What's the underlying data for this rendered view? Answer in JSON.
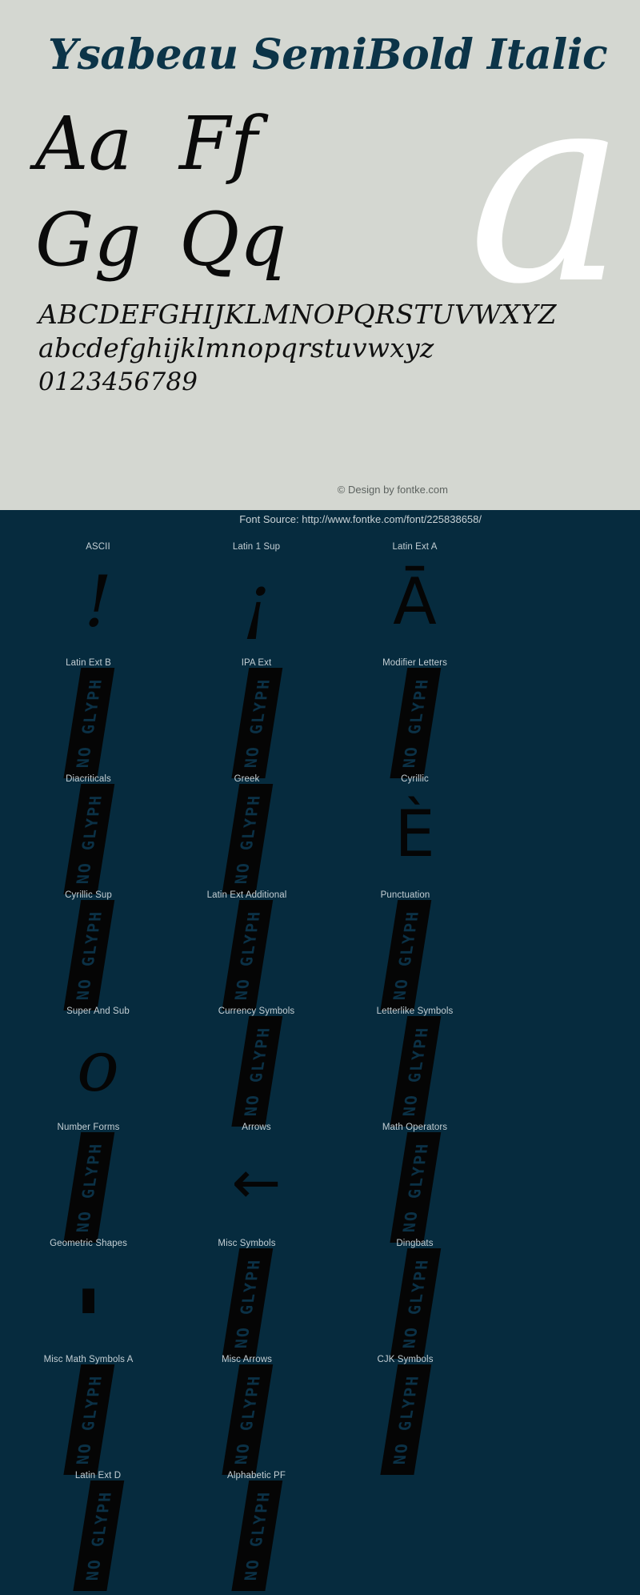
{
  "specimen": {
    "title": "Ysabeau SemiBold Italic",
    "hero_glyph": "a",
    "pairs": [
      "Aa",
      "Ff",
      "Gg",
      "Qq"
    ],
    "alphabet_upper": "ABCDEFGHIJKLMNOPQRSTUVWXYZ",
    "alphabet_lower": "abcdefghijklmnopqrstuvwxyz",
    "digits": "0123456789",
    "design_credit": "© Design by fontke.com",
    "background_color": "#d4d7d1",
    "title_color": "#0c3448"
  },
  "source": {
    "text": "Font Source: http://www.fontke.com/font/225838658/",
    "background_color": "#062b3e",
    "text_color": "#c9d2d6"
  },
  "blocks": {
    "no_glyph_label": "NO GLYPH",
    "items": [
      {
        "label": "ASCII",
        "sample": "!",
        "kind": "glyph"
      },
      {
        "label": "Latin 1 Sup",
        "sample": "¡",
        "kind": "glyph"
      },
      {
        "label": "Latin Ext A",
        "sample": "Ā",
        "kind": "glyph-sans"
      },
      {
        "label": "Latin Ext B",
        "sample": "",
        "kind": "noglyph"
      },
      {
        "label": "IPA Ext",
        "sample": "",
        "kind": "noglyph"
      },
      {
        "label": "Modifier Letters",
        "sample": "",
        "kind": "noglyph"
      },
      {
        "label": "Diacriticals",
        "sample": "",
        "kind": "noglyph"
      },
      {
        "label": "Greek",
        "sample": "",
        "kind": "noglyph"
      },
      {
        "label": "Cyrillic",
        "sample": "È",
        "kind": "glyph-sans"
      },
      {
        "label": "Cyrillic Sup",
        "sample": "",
        "kind": "noglyph"
      },
      {
        "label": "Latin Ext Additional",
        "sample": "",
        "kind": "noglyph"
      },
      {
        "label": "Punctuation",
        "sample": "",
        "kind": "noglyph"
      },
      {
        "label": "Super And Sub",
        "sample": "o",
        "kind": "glyph"
      },
      {
        "label": "Currency Symbols",
        "sample": "",
        "kind": "noglyph"
      },
      {
        "label": "Letterlike Symbols",
        "sample": "",
        "kind": "noglyph"
      },
      {
        "label": "Number Forms",
        "sample": "",
        "kind": "noglyph"
      },
      {
        "label": "Arrows",
        "sample": "←",
        "kind": "glyph-arrow"
      },
      {
        "label": "Math Operators",
        "sample": "",
        "kind": "noglyph"
      },
      {
        "label": "Geometric Shapes",
        "sample": "▮",
        "kind": "glyph-shape"
      },
      {
        "label": "Misc Symbols",
        "sample": "",
        "kind": "noglyph"
      },
      {
        "label": "Dingbats",
        "sample": "",
        "kind": "noglyph"
      },
      {
        "label": "Misc Math Symbols A",
        "sample": "",
        "kind": "noglyph"
      },
      {
        "label": "Misc Arrows",
        "sample": "",
        "kind": "noglyph"
      },
      {
        "label": "CJK Symbols",
        "sample": "",
        "kind": "noglyph"
      },
      {
        "label": "Latin Ext D",
        "sample": "",
        "kind": "noglyph"
      },
      {
        "label": "Alphabetic PF",
        "sample": "",
        "kind": "noglyph"
      }
    ]
  }
}
